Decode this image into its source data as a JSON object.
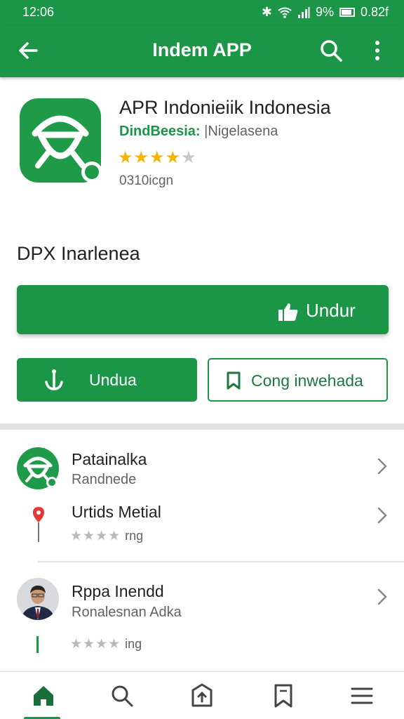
{
  "status_bar": {
    "time": "12:06",
    "battery_text": "9%",
    "extra": "0.82f"
  },
  "app_bar": {
    "title": "Indem APP",
    "back_icon": "arrow-left-icon",
    "search_icon": "search-icon",
    "menu_icon": "more-vertical-icon"
  },
  "app": {
    "name": "APR Indonieiik Indonesia",
    "developer_accent": "DindBeesia:",
    "developer_rest": " |Nigelasena",
    "rating": 4.5,
    "stars_display": "★★★★",
    "star_half": "★",
    "size_text": "0310icgn",
    "icon": "app-logo-icon"
  },
  "section": {
    "label": "DPX Inarlenea"
  },
  "buttons": {
    "primary": {
      "label": "Undur",
      "icon": "thumbs-up-icon"
    },
    "secondary": {
      "label": "Undua",
      "icon": "anchor-icon"
    },
    "outline": {
      "label": "Cong inwehada",
      "icon": "bookmark-icon"
    }
  },
  "list": [
    {
      "title": "Patainalka",
      "subtitle": "Randnede",
      "icon": "app-logo-icon"
    },
    {
      "title": "Urtids Metial",
      "stars": "★★★★",
      "stars_text": "rng",
      "icon": "map-pin-icon"
    },
    {
      "title": "Rppa Inendd",
      "subtitle": "Ronalesnan Adka",
      "stars": "★★★★",
      "stars_text": "ing",
      "icon": "person-avatar"
    }
  ],
  "bottom_nav": [
    {
      "name": "home",
      "icon": "home-icon",
      "active": true
    },
    {
      "name": "search",
      "icon": "search-icon",
      "active": false
    },
    {
      "name": "updates",
      "icon": "upload-box-icon",
      "active": false
    },
    {
      "name": "bookmarks",
      "icon": "bookmark-icon",
      "active": false
    },
    {
      "name": "menu",
      "icon": "hamburger-menu-icon",
      "active": false
    }
  ],
  "colors": {
    "brand": "#1b9647",
    "star": "#f4b400",
    "text": "#202124",
    "muted": "#5f6368"
  }
}
